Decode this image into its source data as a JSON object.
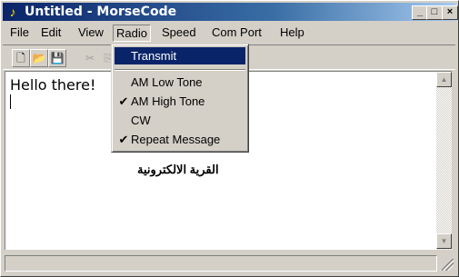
{
  "window": {
    "title": "Untitled - MorseCode",
    "controls": {
      "minimize": "_",
      "maximize": "□",
      "close": "×"
    }
  },
  "menubar": [
    "File",
    "Edit",
    "View",
    "Radio",
    "Speed",
    "Com Port",
    "Help"
  ],
  "toolbar": {
    "tools": [
      {
        "name": "new-icon",
        "glyph": "🗋"
      },
      {
        "name": "open-icon",
        "glyph": "📂"
      },
      {
        "name": "save-icon",
        "glyph": "💾"
      },
      {
        "name": "cut-icon",
        "glyph": "✂"
      },
      {
        "name": "copy-icon",
        "glyph": "⎘"
      }
    ]
  },
  "document": {
    "text": "Hello there!",
    "watermark": "القرية الالكترونية"
  },
  "radio_menu": {
    "items": [
      {
        "label": "Transmit",
        "checked": false,
        "highlighted": true
      },
      {
        "separator": true
      },
      {
        "label": "AM Low Tone",
        "checked": false
      },
      {
        "label": "AM High Tone",
        "checked": true
      },
      {
        "label": "CW",
        "checked": false
      },
      {
        "label": "Repeat Message",
        "checked": true
      }
    ],
    "check_glyph": "✔"
  },
  "scrollbar": {
    "up": "▲",
    "down": "▼"
  },
  "colors": {
    "title_active": "#0a246a",
    "highlight": "#0a246a",
    "face": "#d4d0c8"
  }
}
